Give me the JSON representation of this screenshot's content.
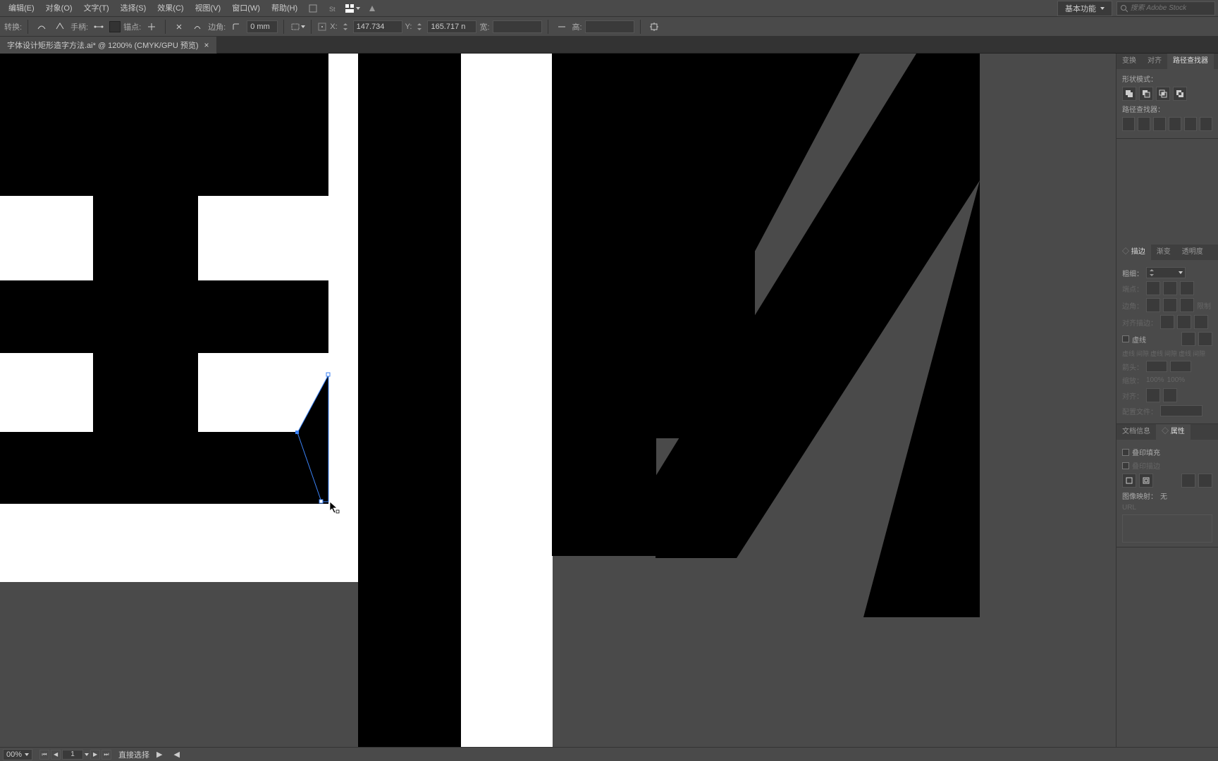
{
  "menu": {
    "edit": "编辑(E)",
    "object": "对象(O)",
    "type": "文字(T)",
    "select": "选择(S)",
    "effect": "效果(C)",
    "view": "视图(V)",
    "window": "窗口(W)",
    "help": "帮助(H)"
  },
  "workspace": {
    "label": "基本功能"
  },
  "search": {
    "placeholder": "搜索 Adobe Stock"
  },
  "control": {
    "tool_label": "转换:",
    "handle": "手柄:",
    "anchor": "锚点:",
    "corner": "边角:",
    "corner_val": "0 mm",
    "x_label": "X:",
    "x_val": "147.734",
    "y_label": "Y:",
    "y_val": "165.717 n",
    "w_label": "宽:",
    "h_label": "高:"
  },
  "doc": {
    "title": "字体设计矩形造字方法.ai* @ 1200% (CMYK/GPU 预览)"
  },
  "panels": {
    "transform": "变换",
    "align": "对齐",
    "pathfinder": "路径查找器",
    "shapemode": "形状模式：",
    "pathfinders": "路径查找器：",
    "stroke": "描边",
    "gradient": "渐变",
    "transparency": "透明度",
    "weight": "粗细：",
    "cap": "端点：",
    "corner": "边角：",
    "limit": "限制",
    "alignStroke": "对齐描边：",
    "dashed": "虚线",
    "dash1": "虚线",
    "gap1": "间隙",
    "dash2": "虚线",
    "gap2": "间隙",
    "dash3": "虚线",
    "gap3": "间隙",
    "arrow": "箭头：",
    "scale": "缩放：",
    "scale_val": "100%",
    "scale_val2": "100%",
    "alignArrow": "对齐：",
    "profile": "配置文件：",
    "docinfo": "文档信息",
    "attributes": "属性",
    "overprint": "叠印填充",
    "overprint2": "叠印描边",
    "imagemap": "图像映射：",
    "imagemap_val": "无",
    "url": "URL"
  },
  "status": {
    "zoom": "00%",
    "artboard": "1",
    "tool": "直接选择"
  }
}
